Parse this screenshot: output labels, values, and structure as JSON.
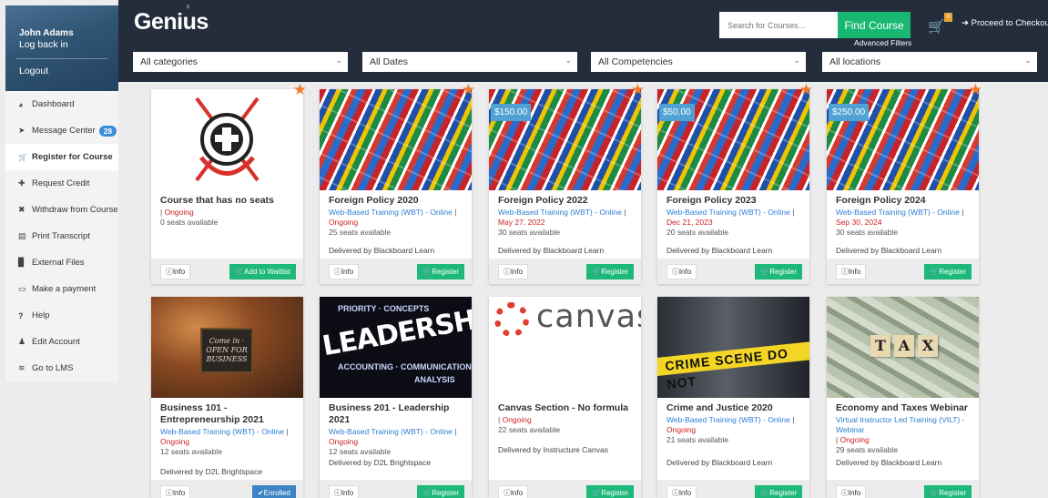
{
  "user": {
    "name": "John Adams",
    "relog": "Log back in",
    "logout": "Logout"
  },
  "nav": [
    {
      "icon": "◕",
      "label": "Dashboard"
    },
    {
      "icon": "➤",
      "label": "Message Center",
      "badge": "28"
    },
    {
      "icon": "🛒",
      "label": "Register for Course"
    },
    {
      "icon": "✚",
      "label": "Request Credit"
    },
    {
      "icon": "✖",
      "label": "Withdraw from Course"
    },
    {
      "icon": "▤",
      "label": "Print Transcript"
    },
    {
      "icon": "▉",
      "label": "External Files"
    },
    {
      "icon": "▭",
      "label": "Make a payment"
    },
    {
      "icon": "?",
      "label": "Help"
    },
    {
      "icon": "♟",
      "label": "Edit Account"
    },
    {
      "icon": "≋",
      "label": "Go to LMS"
    }
  ],
  "header": {
    "logo": "Genius",
    "search_placeholder": "Search for Courses...",
    "find_label": "Find Course",
    "advanced": "Advanced Filters",
    "cart_count": "0",
    "checkout": "Proceed to Checkout"
  },
  "filters": [
    "All categories",
    "All Dates",
    "All Competencies",
    "All locations"
  ],
  "cards": [
    {
      "title": "Course that has no seats",
      "type": "",
      "date": "Ongoing",
      "seats": "0 seats available",
      "delivered": "",
      "action": "Add to Waitlist",
      "price": ""
    },
    {
      "title": "Foreign Policy 2020",
      "type": "Web-Based Training (WBT) - Online",
      "date": "Ongoing",
      "seats": "25 seats available",
      "delivered": "Delivered by Blackboard Learn",
      "action": "Register",
      "price": ""
    },
    {
      "title": "Foreign Policy 2022",
      "type": "Web-Based Training (WBT) - Online",
      "date": "May 27, 2022",
      "seats": "30 seats available",
      "delivered": "Delivered by Blackboard Learn",
      "action": "Register",
      "price": "$150.00"
    },
    {
      "title": "Foreign Policy 2023",
      "type": "Web-Based Training (WBT) - Online",
      "date": "Dec 21, 2023",
      "seats": "20 seats available",
      "delivered": "Delivered by Blackboard Learn",
      "action": "Register",
      "price": "$50.00"
    },
    {
      "title": "Foreign Policy 2024",
      "type": "Web-Based Training (WBT) - Online",
      "date": "Sep 30, 2024",
      "seats": "30 seats available",
      "delivered": "Delivered by Blackboard Learn",
      "action": "Register",
      "price": "$250.00"
    },
    {
      "title": "Business 101 - Entrepreneurship 2021",
      "type": "Web-Based Training (WBT) - Online",
      "date": "Ongoing",
      "seats": "12 seats available",
      "delivered": "Delivered by D2L Brightspace",
      "action": "Enrolled",
      "price": ""
    },
    {
      "title": "Business 201 - Leadership 2021",
      "type": "Web-Based Training (WBT) - Online",
      "date": "Ongoing",
      "seats": "12 seats available",
      "delivered": "Delivered by D2L Brightspace",
      "action": "Register",
      "price": ""
    },
    {
      "title": "Canvas Section - No formula",
      "type": "",
      "date": "Ongoing",
      "seats": "22 seats available",
      "delivered": "Delivered by Instructure Canvas",
      "action": "Register",
      "price": ""
    },
    {
      "title": "Crime and Justice 2020",
      "type": "Web-Based Training (WBT) - Online",
      "date": "Ongoing",
      "seats": "21 seats available",
      "delivered": "Delivered by Blackboard Learn",
      "action": "Register",
      "price": ""
    },
    {
      "title": "Economy and Taxes Webinar",
      "type": "Virtual Instructor Led Training (VILT) - Webinar",
      "date": "Ongoing",
      "seats": "29 seats available",
      "delivered": "Delivered by Blackboard Learn",
      "action": "Register",
      "price": ""
    }
  ],
  "images": {
    "business_sign": "Come in · OPEN FOR BUSINESS",
    "leadership": "LEADERSHIP",
    "canvas": "canvas",
    "crime_tape": "CRIME SCENE DO NOT",
    "tax_tiles": [
      "T",
      "A",
      "X"
    ]
  },
  "info_label": "Info",
  "colors": {
    "header": "#242d3c",
    "accent_green": "#19b872",
    "link_blue": "#2c7fd3",
    "date_red": "#cc1f1f",
    "enrolled_blue": "#3c84c4",
    "price_blue": "#4fa2d3",
    "star_orange": "#f07a2a"
  }
}
